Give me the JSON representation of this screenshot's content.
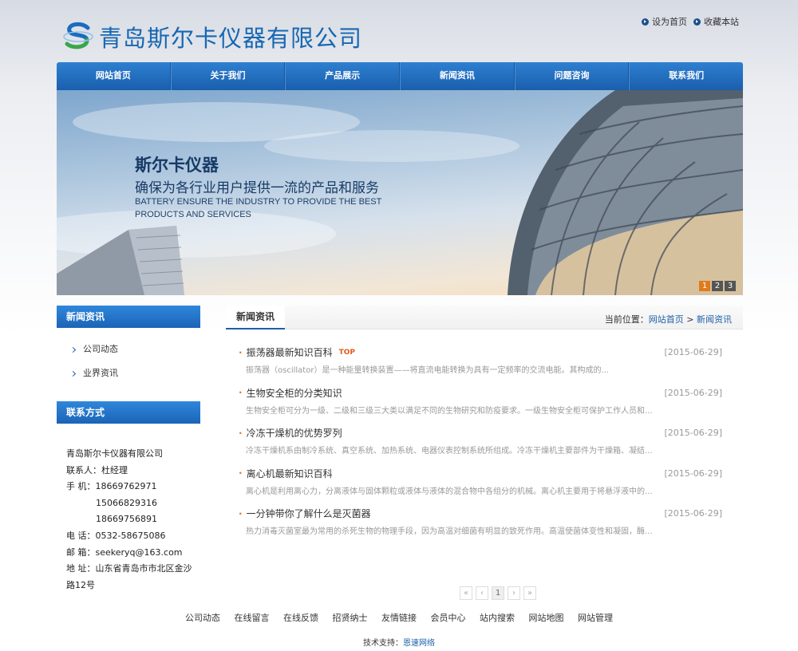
{
  "header": {
    "company_name": "青岛斯尔卡仪器有限公司",
    "top_links": [
      "设为首页",
      "收藏本站"
    ]
  },
  "nav": [
    "网站首页",
    "关于我们",
    "产品展示",
    "新闻资讯",
    "问题咨询",
    "联系我们"
  ],
  "banner": {
    "title": "斯尔卡仪器",
    "subtitle": "确保为各行业用户提供一流的产品和服务",
    "english": "BATTERY ENSURE THE INDUSTRY TO PROVIDE THE BEST PRODUCTS AND SERVICES",
    "slides": [
      "1",
      "2",
      "3"
    ]
  },
  "sidebar": {
    "news_heading": "新闻资讯",
    "news_items": [
      "公司动态",
      "业界资讯"
    ],
    "contact_heading": "联系方式",
    "contact": {
      "company": "青岛斯尔卡仪器有限公司",
      "person": "联系人：杜经理",
      "mobile_label": "手 机：",
      "mobile_1": "18669762971",
      "mobile_2": "15066829316",
      "mobile_3": "18669756891",
      "phone": "电 话：0532-58675086",
      "email": "邮 箱：seekeryq@163.com",
      "address": "地 址：山东省青岛市市北区金沙",
      "address_2": "路12号"
    }
  },
  "main": {
    "tab": "新闻资讯",
    "crumb_prefix": "当前位置：",
    "crumb_home": "网站首页",
    "crumb_sep": ">",
    "crumb_current": "新闻资讯",
    "news": [
      {
        "title": "振荡器最新知识百科",
        "badge": "TOP",
        "date": "[2015-06-29]",
        "desc": "振荡器（oscillator）是一种能量转换装置——将直流电能转换为具有一定频率的交流电能。其构成的..."
      },
      {
        "title": "生物安全柜的分类知识",
        "badge": "",
        "date": "[2015-06-29]",
        "desc": "生物安全柜可分为一级、二级和三级三大类以满足不同的生物研究和防疫要求。一级生物安全柜可保护工作人员和..."
      },
      {
        "title": "冷冻干燥机的优势罗列",
        "badge": "",
        "date": "[2015-06-29]",
        "desc": "冷冻干燥机系由制冷系统、真空系统、加热系统、电器仪表控制系统所组成。冷冻干燥机主要部件为干燥箱、凝结..."
      },
      {
        "title": "离心机最新知识百科",
        "badge": "",
        "date": "[2015-06-29]",
        "desc": "离心机是利用离心力，分离液体与固体颗粒或液体与液体的混合物中各组分的机械。离心机主要用于将悬浮液中的..."
      },
      {
        "title": "一分钟带你了解什么是灭菌器",
        "badge": "",
        "date": "[2015-06-29]",
        "desc": "热力消毒灭菌室最为常用的杀死生物的物理手段，因为高温对细菌有明显的致死作用。高温使菌体变性和凝固，酶..."
      }
    ],
    "pager": [
      "«",
      "‹",
      "1",
      "›",
      "»"
    ]
  },
  "footer": {
    "links": [
      "公司动态",
      "在线留言",
      "在线反馈",
      "招贤纳士",
      "友情链接",
      "会员中心",
      "站内搜索",
      "网站地图",
      "网站管理"
    ],
    "tech_label": "技术支持：",
    "tech_link": "恩速网络"
  },
  "colors": {
    "brand": "#1767b2",
    "nav": "#1a5fae",
    "accent": "#e07b1c"
  }
}
